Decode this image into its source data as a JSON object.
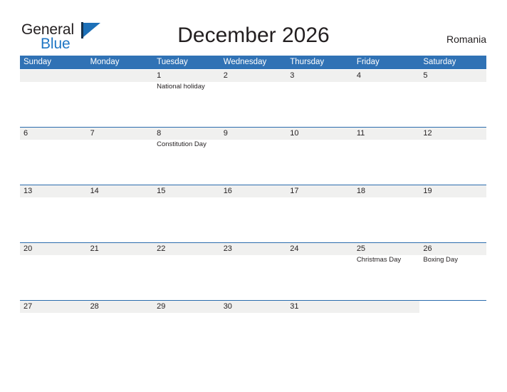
{
  "brand": {
    "name_part1": "General",
    "name_part2": "Blue",
    "flag_color": "#1d70b8",
    "blue_text_color": "#1f76c4"
  },
  "header": {
    "title": "December 2026",
    "country": "Romania"
  },
  "theme": {
    "header_blue": "#3072b5",
    "separator_blue": "#2b6cad",
    "band_gray": "#f0f0ef",
    "text_color": "#231f20"
  },
  "calendar": {
    "month": "December",
    "year": "2026",
    "day_headers": [
      "Sunday",
      "Monday",
      "Tuesday",
      "Wednesday",
      "Thursday",
      "Friday",
      "Saturday"
    ],
    "weeks": [
      {
        "days": [
          {
            "num": "",
            "event": ""
          },
          {
            "num": "",
            "event": ""
          },
          {
            "num": "1",
            "event": "National holiday"
          },
          {
            "num": "2",
            "event": ""
          },
          {
            "num": "3",
            "event": ""
          },
          {
            "num": "4",
            "event": ""
          },
          {
            "num": "5",
            "event": ""
          }
        ]
      },
      {
        "days": [
          {
            "num": "6",
            "event": ""
          },
          {
            "num": "7",
            "event": ""
          },
          {
            "num": "8",
            "event": "Constitution Day"
          },
          {
            "num": "9",
            "event": ""
          },
          {
            "num": "10",
            "event": ""
          },
          {
            "num": "11",
            "event": ""
          },
          {
            "num": "12",
            "event": ""
          }
        ]
      },
      {
        "days": [
          {
            "num": "13",
            "event": ""
          },
          {
            "num": "14",
            "event": ""
          },
          {
            "num": "15",
            "event": ""
          },
          {
            "num": "16",
            "event": ""
          },
          {
            "num": "17",
            "event": ""
          },
          {
            "num": "18",
            "event": ""
          },
          {
            "num": "19",
            "event": ""
          }
        ]
      },
      {
        "days": [
          {
            "num": "20",
            "event": ""
          },
          {
            "num": "21",
            "event": ""
          },
          {
            "num": "22",
            "event": ""
          },
          {
            "num": "23",
            "event": ""
          },
          {
            "num": "24",
            "event": ""
          },
          {
            "num": "25",
            "event": "Christmas Day"
          },
          {
            "num": "26",
            "event": "Boxing Day"
          }
        ]
      },
      {
        "days": [
          {
            "num": "27",
            "event": ""
          },
          {
            "num": "28",
            "event": ""
          },
          {
            "num": "29",
            "event": ""
          },
          {
            "num": "30",
            "event": ""
          },
          {
            "num": "31",
            "event": ""
          },
          {
            "num": "",
            "event": ""
          },
          {
            "num": "",
            "event": ""
          }
        ]
      }
    ]
  }
}
